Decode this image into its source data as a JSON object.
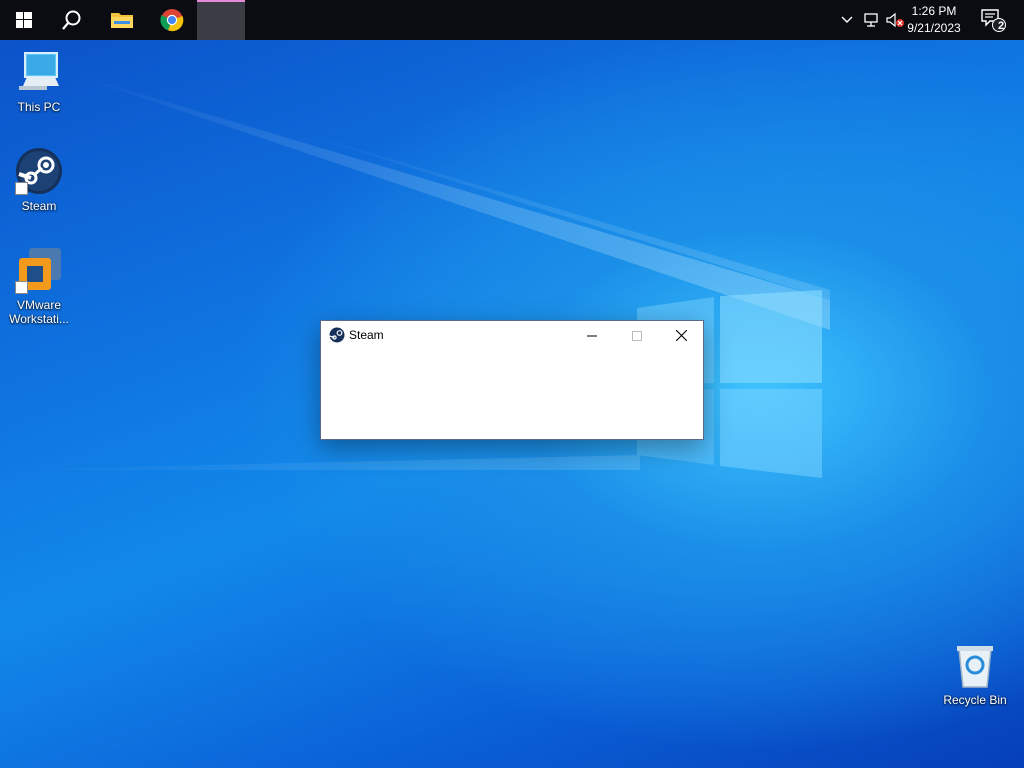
{
  "taskbar": {
    "start": "start-button",
    "search": "search-button",
    "pinned": [
      {
        "name": "file-explorer"
      },
      {
        "name": "google-chrome"
      },
      {
        "name": "active-window"
      }
    ],
    "tray": {
      "chevron": "show-hidden-icons",
      "network": "network-icon",
      "volume": "volume-muted-icon",
      "time": "1:26 PM",
      "date": "9/21/2023",
      "notifications_count": "2"
    }
  },
  "desktop": {
    "icons": [
      {
        "label": "This PC"
      },
      {
        "label": "Steam"
      },
      {
        "label": "VMware Workstati..."
      },
      {
        "label": "Recycle Bin"
      }
    ]
  },
  "window": {
    "title": "Steam"
  },
  "colors": {
    "taskbar": "#0a0c12",
    "desktop_accent": "#1289ea",
    "active_indicator": "#e58ad9"
  }
}
